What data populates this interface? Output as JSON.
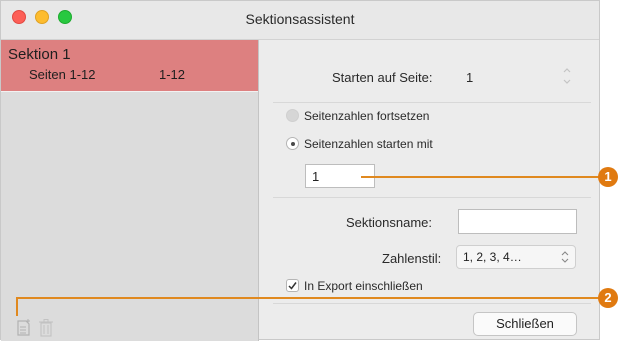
{
  "window": {
    "title": "Sektionsassistent"
  },
  "sidebar": {
    "section_title": "Sektion 1",
    "section_pages_label": "Seiten 1-12",
    "section_pages_range": "1-12"
  },
  "panel": {
    "start_page_label": "Starten auf Seite:",
    "start_page_value": "1",
    "radio_continue_label": "Seitenzahlen fortsetzen",
    "radio_start_label": "Seitenzahlen starten mit",
    "start_number_value": "1",
    "section_name_label": "Sektionsname:",
    "section_name_value": "",
    "number_style_label": "Zahlenstil:",
    "number_style_value": "1, 2, 3, 4…",
    "include_export_label": "In Export einschließen",
    "include_export_checked": true,
    "close_button_label": "Schließen"
  },
  "callouts": [
    "1",
    "2"
  ],
  "colors": {
    "selection": "#dd8080",
    "callout": "#e07a10"
  }
}
